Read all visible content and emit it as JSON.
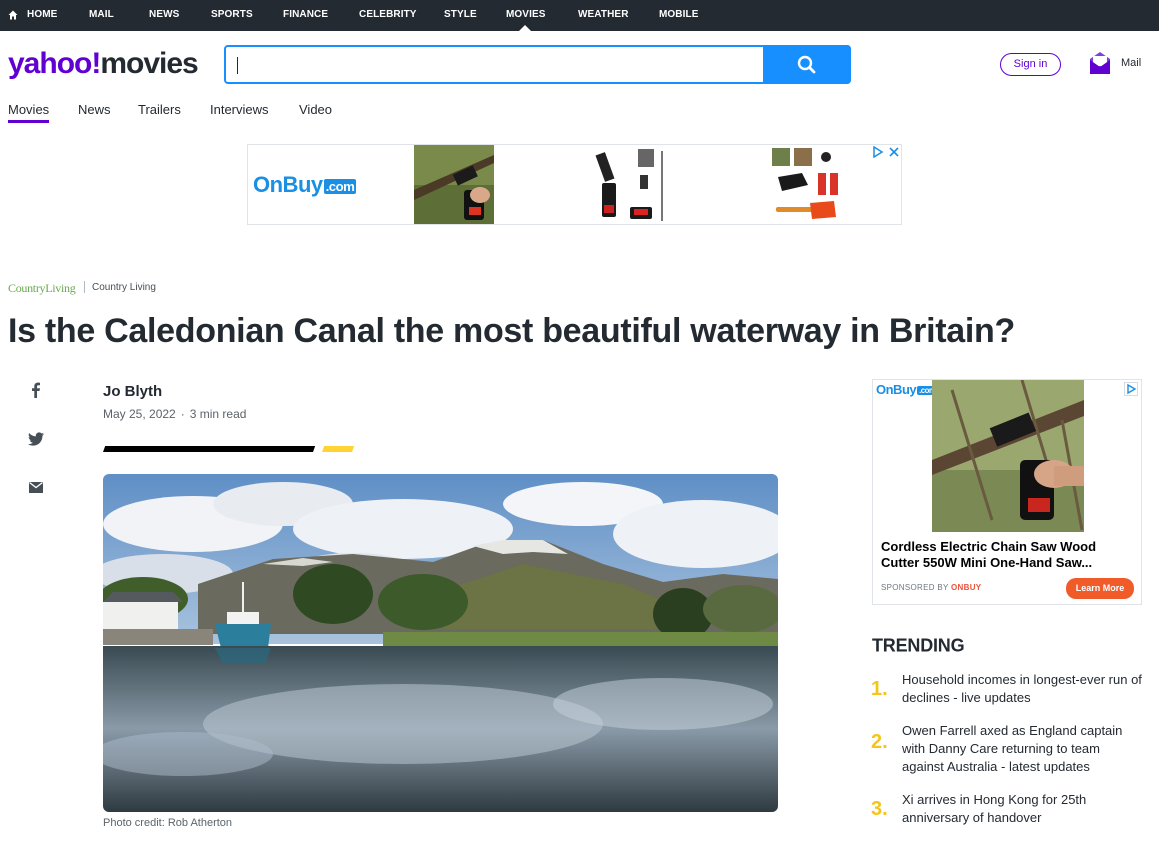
{
  "top_nav": {
    "items": [
      "HOME",
      "MAIL",
      "NEWS",
      "SPORTS",
      "FINANCE",
      "CELEBRITY",
      "STYLE",
      "MOVIES",
      "WEATHER",
      "MOBILE"
    ],
    "active": "MOVIES"
  },
  "header": {
    "logo_yahoo": "yahoo!",
    "logo_section": "movies",
    "search_value": "",
    "signin_label": "Sign in",
    "mail_label": "Mail"
  },
  "sub_nav": {
    "items": [
      "Movies",
      "News",
      "Trailers",
      "Interviews",
      "Video"
    ],
    "active": "Movies"
  },
  "top_ad": {
    "brand": "OnBuy",
    "brand_suffix": ".com"
  },
  "article": {
    "source_logo": "CountryLiving",
    "source_name": "Country Living",
    "headline": "Is the Caledonian Canal the most beautiful waterway in Britain?",
    "author": "Jo Blyth",
    "date": "May 25, 2022",
    "read_time": "3 min read",
    "photo_credit": "Photo credit: Rob Atherton"
  },
  "side_ad": {
    "brand": "OnBuy",
    "brand_suffix": ".com",
    "title_line1": "Cordless Electric Chain Saw Wood",
    "title_line2": "Cutter 550W Mini One-Hand Saw...",
    "sponsor_prefix": "SPONSORED BY",
    "sponsor_name": "ONBUY",
    "cta": "Learn More"
  },
  "trending": {
    "title": "TRENDING",
    "items": [
      {
        "num": "1.",
        "text": "Household incomes in longest-ever run of declines - live updates"
      },
      {
        "num": "2.",
        "text": "Owen Farrell axed as England captain with Danny Care returning to team against Australia - latest updates"
      },
      {
        "num": "3.",
        "text": "Xi arrives in Hong Kong for 25th anniversary of handover"
      }
    ]
  },
  "colors": {
    "yahoo_purple": "#6001d2",
    "search_blue": "#188fff",
    "nav_bg": "#232a31",
    "trending_number": "#f5c518",
    "ad_orange": "#f15a29"
  },
  "icons": [
    "home-icon",
    "search-icon",
    "mail-icon",
    "facebook-icon",
    "twitter-icon",
    "email-icon",
    "adchoices-icon",
    "close-icon"
  ]
}
